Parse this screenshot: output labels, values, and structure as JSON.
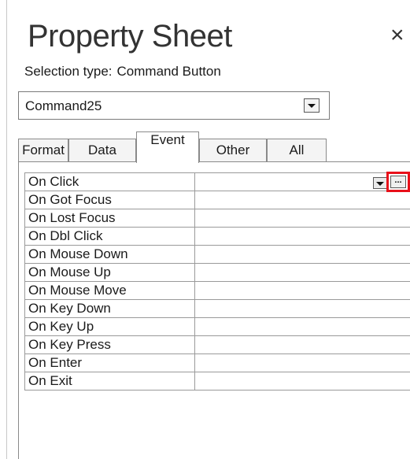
{
  "panel": {
    "title": "Property Sheet",
    "close_glyph": "×",
    "selection_type_label": "Selection type:",
    "selection_type_value": "Command Button"
  },
  "object_selector": {
    "value": "Command25"
  },
  "tabs": [
    {
      "label": "Format",
      "active": false
    },
    {
      "label": "Data",
      "active": false
    },
    {
      "label": "Event",
      "active": true
    },
    {
      "label": "Other",
      "active": false
    },
    {
      "label": "All",
      "active": false
    }
  ],
  "properties": [
    {
      "name": "On Click",
      "value": ""
    },
    {
      "name": "On Got Focus",
      "value": ""
    },
    {
      "name": "On Lost Focus",
      "value": ""
    },
    {
      "name": "On Dbl Click",
      "value": ""
    },
    {
      "name": "On Mouse Down",
      "value": ""
    },
    {
      "name": "On Mouse Up",
      "value": ""
    },
    {
      "name": "On Mouse Move",
      "value": ""
    },
    {
      "name": "On Key Down",
      "value": ""
    },
    {
      "name": "On Key Up",
      "value": ""
    },
    {
      "name": "On Key Press",
      "value": ""
    },
    {
      "name": "On Enter",
      "value": ""
    },
    {
      "name": "On Exit",
      "value": ""
    }
  ],
  "builder_button": {
    "label": "...",
    "icon": "ellipsis-icon",
    "highlight_color": "#e8101a"
  }
}
